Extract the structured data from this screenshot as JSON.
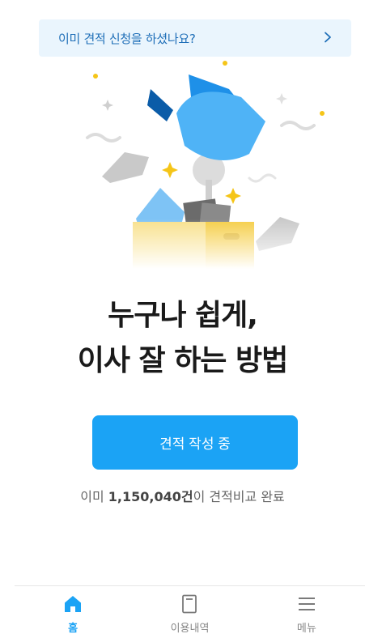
{
  "banner": {
    "text": "이미 견적 신청을 하셨나요?",
    "icon": "chevron-right-icon",
    "color": "#1f6fb8",
    "background": "#eaf5fd"
  },
  "headline": {
    "line1": "누구나 쉽게,",
    "line2": "이사 잘 하는 방법"
  },
  "cta": {
    "label": "견적 작성 중",
    "color": "#1ba3f5"
  },
  "stats": {
    "prefix": "이미 ",
    "count": "1,150,040건",
    "suffix": "이 견적비교 완료"
  },
  "tabbar": {
    "items": [
      {
        "label": "홈",
        "icon": "home-icon",
        "active": true
      },
      {
        "label": "이용내역",
        "icon": "document-icon",
        "active": false
      },
      {
        "label": "메뉴",
        "icon": "hamburger-menu-icon",
        "active": false
      }
    ],
    "active_color": "#1ba3f5"
  }
}
